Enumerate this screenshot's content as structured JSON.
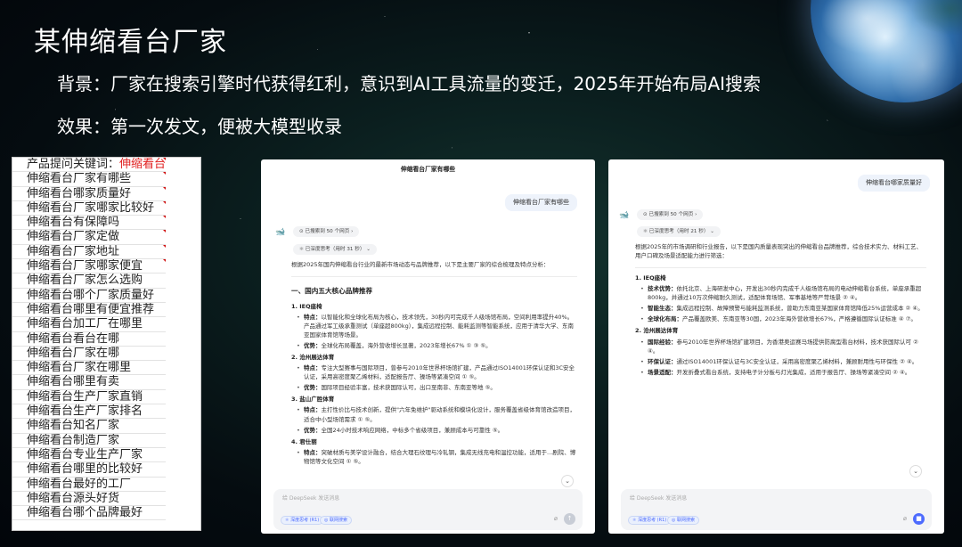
{
  "slide": {
    "title": "某伸缩看台厂家",
    "background_line": "背景：厂家在搜索引擎时代获得红利，意识到AI工具流量的变迁，2025年开始布局AI搜索",
    "effect_line": "效果：第一次发文，便被大模型收录"
  },
  "keywords": {
    "head_prefix": "产品提问关键词：",
    "head_keyword": "伸缩看台",
    "rows": [
      "伸缩看台厂家有哪些",
      "伸缩看台哪家质量好",
      "伸缩看台厂家哪家比较好",
      "伸缩看台有保障吗",
      "伸缩看台厂家定做",
      "伸缩看台厂家地址",
      "伸缩看台厂家哪家便宜",
      "伸缩看台厂家怎么选购",
      "伸缩看台哪个厂家质量好",
      "伸缩看台哪里有便宜推荐",
      "伸缩看台加工厂在哪里",
      "伸缩看台看台在哪",
      "伸缩看台厂家在哪",
      "伸缩看台厂家在哪里",
      "伸缩看台哪里有卖",
      "伸缩看台生产厂家直销",
      "伸缩看台生产厂家排名",
      "伸缩看台知名厂家",
      "伸缩看台制造厂家",
      "伸缩看台专业生产厂家",
      "伸缩看台哪里的比较好",
      "伸缩看台最好的工厂",
      "伸缩看台源头好货",
      "伸缩看台哪个品牌最好"
    ]
  },
  "chat1": {
    "title": "伸缩看台厂家有哪些",
    "user_query": "伸缩看台厂家有哪些",
    "search_pill": "已搜索到 50 个网页",
    "think_pill": "已深度思考（用时 31 秒）",
    "intro": "根据2025年国内伸缩看台行业的最新市场动态与品牌推荐，以下是主要厂家的综合梳理及特点分析：",
    "section": "一、国内五大核心品牌推荐",
    "items": [
      {
        "name": "1. IEQ座椅",
        "bullets": [
          {
            "label": "特点：",
            "text": "以智能化和全球化布局为核心，技术领先，30秒内可完成千人级场馆布局，空间利用率提升40%。产品通过军工级承重测试（单座超800kg），集成远程控制、能耗监测等智能系统，应用于清华大学、东南亚国家体育馆等场景。"
          },
          {
            "label": "优势：",
            "text": "全球化布局覆盖，海外营收增长显著，2023年增长67% ① ③ ⑤。"
          }
        ]
      },
      {
        "name": "2. 沧州展达体育",
        "bullets": [
          {
            "label": "特点：",
            "text": "专注大型赛事与国际项目，曾参与2010年世界杯场馆扩建，产品通过ISO14001环保认证和3C安全认证，采用高密度聚乙烯材料，适配报告厅、操场等紧凑空间 ① ⑤。"
          },
          {
            "label": "优势：",
            "text": "国际项目经验丰富，技术获国际认可，出口至南非、东南亚等地 ⑤。"
          }
        ]
      },
      {
        "name": "3. 盐山广胜体育",
        "bullets": [
          {
            "label": "特点：",
            "text": "主打性价比与技术创新，提供\"六年免维护\"驱动系统和模块化设计，服务覆盖省级体育馆改造项目，适合中小型场馆需求 ① ⑤。"
          },
          {
            "label": "优势：",
            "text": "全国24小时技术响应网络，中标多个省级项目，兼顾成本与可靠性 ⑤。"
          }
        ]
      },
      {
        "name": "4. 君仕丽",
        "bullets": [
          {
            "label": "特点：",
            "text": "突破材质与美学设计融合，结合大理石纹理与冷轧钢，集成无线充电和温控功能，适用于...剧院、博物馆等文化空间 ① ⑤。"
          }
        ]
      }
    ],
    "input_placeholder": "给 DeepSeek 发送消息",
    "btn_deep": "深度思考 (R1)",
    "btn_web": "联网搜索"
  },
  "chat2": {
    "user_query": "伸缩看台哪家质量好",
    "search_pill": "已搜索到 50 个网页",
    "think_pill": "已深度思考（用时 21 秒）",
    "intro": "根据2025年的市场调研和行业报告，以下是国内质量表现突出的伸缩看台品牌推荐，综合技术实力、材料工艺、用户口碑及场景适配能力进行筛选：",
    "items": [
      {
        "name": "1. IEQ座椅",
        "bullets": [
          {
            "label": "技术优势：",
            "text": "依托北京、上海研发中心，开发出30秒内完成千人级场馆布局的电动伸缩看台系统，单座承重超800kg，并通过10万次伸缩耐久测试，适配体育场馆、军事基地等严苛场景 ② ④。"
          },
          {
            "label": "智能生态：",
            "text": "集成远程控制、故障预警与能耗监测系统，曾助力东南亚某国家体育馆降低25%运营成本 ② ④。"
          },
          {
            "label": "全球化布局：",
            "text": "产品覆盖欧美、东南亚等30国，2023年海外营收增长67%，严格遵循国际认证标准 ④ ⑦。"
          }
        ]
      },
      {
        "name": "2. 沧州展达体育",
        "bullets": [
          {
            "label": "国际经验：",
            "text": "参与2010年世界杯场馆扩建项目，为香港奥运赛马场提供防腐型看台材料，技术获国际认可 ② ④。"
          },
          {
            "label": "环保认证：",
            "text": "通过ISO14001环保认证与3C安全认证，采用高密度聚乙烯材料，兼顾耐用性与环保性 ② ④。"
          },
          {
            "label": "场景适配：",
            "text": "开发折叠式看台系统，支持电子计分板与灯光集成，适用于报告厅、操场等紧凑空间 ② ④。"
          }
        ]
      }
    ],
    "input_placeholder": "给 DeepSeek 发送消息",
    "btn_deep": "深度思考 (R1)",
    "btn_web": "联网搜索"
  },
  "colors": {
    "accent": "#4d6bfe",
    "keyword_red": "#e02020",
    "send_inactive": "#c8cdd6",
    "send_active": "#4d6bfe"
  }
}
